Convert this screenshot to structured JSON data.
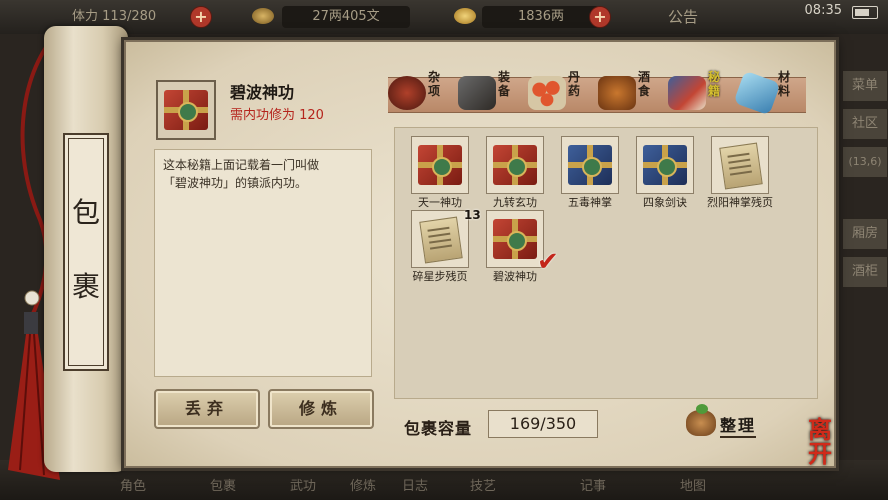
{
  "hud": {
    "stamina_label": "体力",
    "stamina": "113/280",
    "money": "27两405文",
    "gold": "1836两",
    "notice": "公告",
    "time": "08:35"
  },
  "side_tabs": [
    "菜单",
    "社区",
    "(13,6)",
    "厢房",
    "酒柜"
  ],
  "bottom_tabs": [
    "角色",
    "包裹",
    "武功",
    "修炼",
    "日志",
    "技艺",
    "记事",
    "地图"
  ],
  "scroll": {
    "title_chars": [
      "包",
      "裹"
    ]
  },
  "item": {
    "name": "碧波神功",
    "requirement": "需内功修为 120",
    "description": "这本秘籍上面记载着一门叫做\n「碧波神功」的镇派内功。"
  },
  "buttons": {
    "discard": "丢弃",
    "practice": "修炼"
  },
  "categories": [
    {
      "label": "杂项",
      "icon": "jar-icon",
      "active": false
    },
    {
      "label": "装备",
      "icon": "weapon-icon",
      "active": false
    },
    {
      "label": "丹药",
      "icon": "pill-icon",
      "active": false
    },
    {
      "label": "酒食",
      "icon": "food-icon",
      "active": false
    },
    {
      "label": "秘籍",
      "icon": "book-icon",
      "active": true
    },
    {
      "label": "材料",
      "icon": "crystal-icon",
      "active": false
    }
  ],
  "inventory": [
    {
      "name": "天一神功",
      "kind": "book-red"
    },
    {
      "name": "九转玄功",
      "kind": "book-red"
    },
    {
      "name": "五毒神掌",
      "kind": "book-blue"
    },
    {
      "name": "四象剑诀",
      "kind": "book-blue"
    },
    {
      "name": "烈阳神掌残页",
      "kind": "paper"
    },
    {
      "name": "碎星步残页",
      "kind": "paper",
      "count": "13"
    },
    {
      "name": "碧波神功",
      "kind": "book-red",
      "selected": true
    }
  ],
  "capacity": {
    "label": "包裹容量",
    "value": "169/350"
  },
  "sort_label": "整理",
  "leave_label": "离开"
}
